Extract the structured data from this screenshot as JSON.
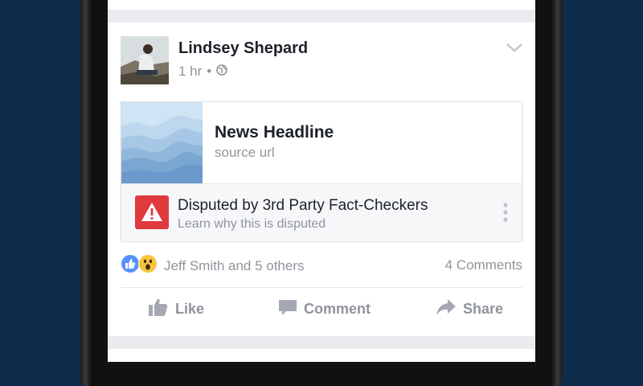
{
  "post": {
    "author": "Lindsey Shepard",
    "time": "1 hr",
    "separator": "•",
    "privacy_icon": "globe-icon"
  },
  "link": {
    "headline": "News Headline",
    "source": "source url"
  },
  "dispute": {
    "title": "Disputed by 3rd Party Fact-Checkers",
    "subtitle": "Learn why this is disputed",
    "icon": "warning-icon",
    "accent": "#e0393e"
  },
  "reactions": {
    "names": "Jeff Smith and 5 others",
    "icons": [
      "like-icon",
      "wow-icon"
    ],
    "comments": "4 Comments"
  },
  "actions": {
    "like": "Like",
    "comment": "Comment",
    "share": "Share"
  },
  "colors": {
    "background": "#0d2c4a",
    "like_blue": "#5890ff",
    "muted": "#90949c"
  }
}
